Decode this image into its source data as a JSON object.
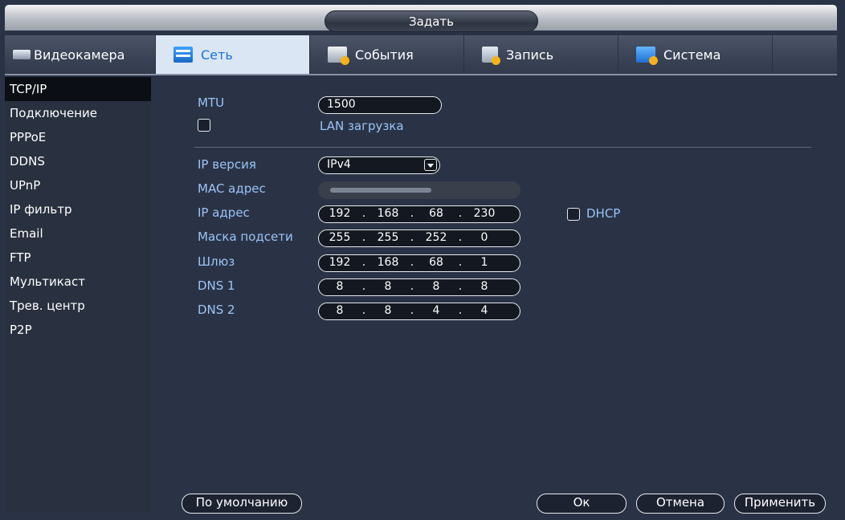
{
  "window": {
    "title": "Задать"
  },
  "tabs": [
    {
      "label": "Видеокамера",
      "icon": "camera-icon"
    },
    {
      "label": "Сеть",
      "icon": "network-icon"
    },
    {
      "label": "События",
      "icon": "events-icon"
    },
    {
      "label": "Запись",
      "icon": "record-icon"
    },
    {
      "label": "Система",
      "icon": "system-icon"
    }
  ],
  "sidebar": {
    "items": [
      {
        "label": "TCP/IP"
      },
      {
        "label": "Подключение"
      },
      {
        "label": "PPPoE"
      },
      {
        "label": "DDNS"
      },
      {
        "label": "UPnP"
      },
      {
        "label": "IP фильтр"
      },
      {
        "label": "Email"
      },
      {
        "label": "FTP"
      },
      {
        "label": "Мультикаст"
      },
      {
        "label": "Трев. центр"
      },
      {
        "label": "P2P"
      }
    ]
  },
  "form": {
    "mtu_label": "MTU",
    "mtu_value": "1500",
    "lan_download_label": "LAN загрузка",
    "ip_version_label": "IP версия",
    "ip_version_value": "IPv4",
    "mac_label": "MAC адрес",
    "ip_label": "IP адрес",
    "ip": [
      "192",
      "168",
      "68",
      "230"
    ],
    "dhcp_label": "DHCP",
    "mask_label": "Маска подсети",
    "mask": [
      "255",
      "255",
      "252",
      "0"
    ],
    "gateway_label": "Шлюз",
    "gateway": [
      "192",
      "168",
      "68",
      "1"
    ],
    "dns1_label": "DNS 1",
    "dns1": [
      "8",
      "8",
      "8",
      "8"
    ],
    "dns2_label": "DNS 2",
    "dns2": [
      "8",
      "8",
      "4",
      "4"
    ]
  },
  "buttons": {
    "default": "По умолчанию",
    "ok": "Ок",
    "cancel": "Отмена",
    "apply": "Применить"
  },
  "colors": {
    "accent": "#1b73d6",
    "label": "#9cc3f5",
    "background": "#2a3346"
  }
}
